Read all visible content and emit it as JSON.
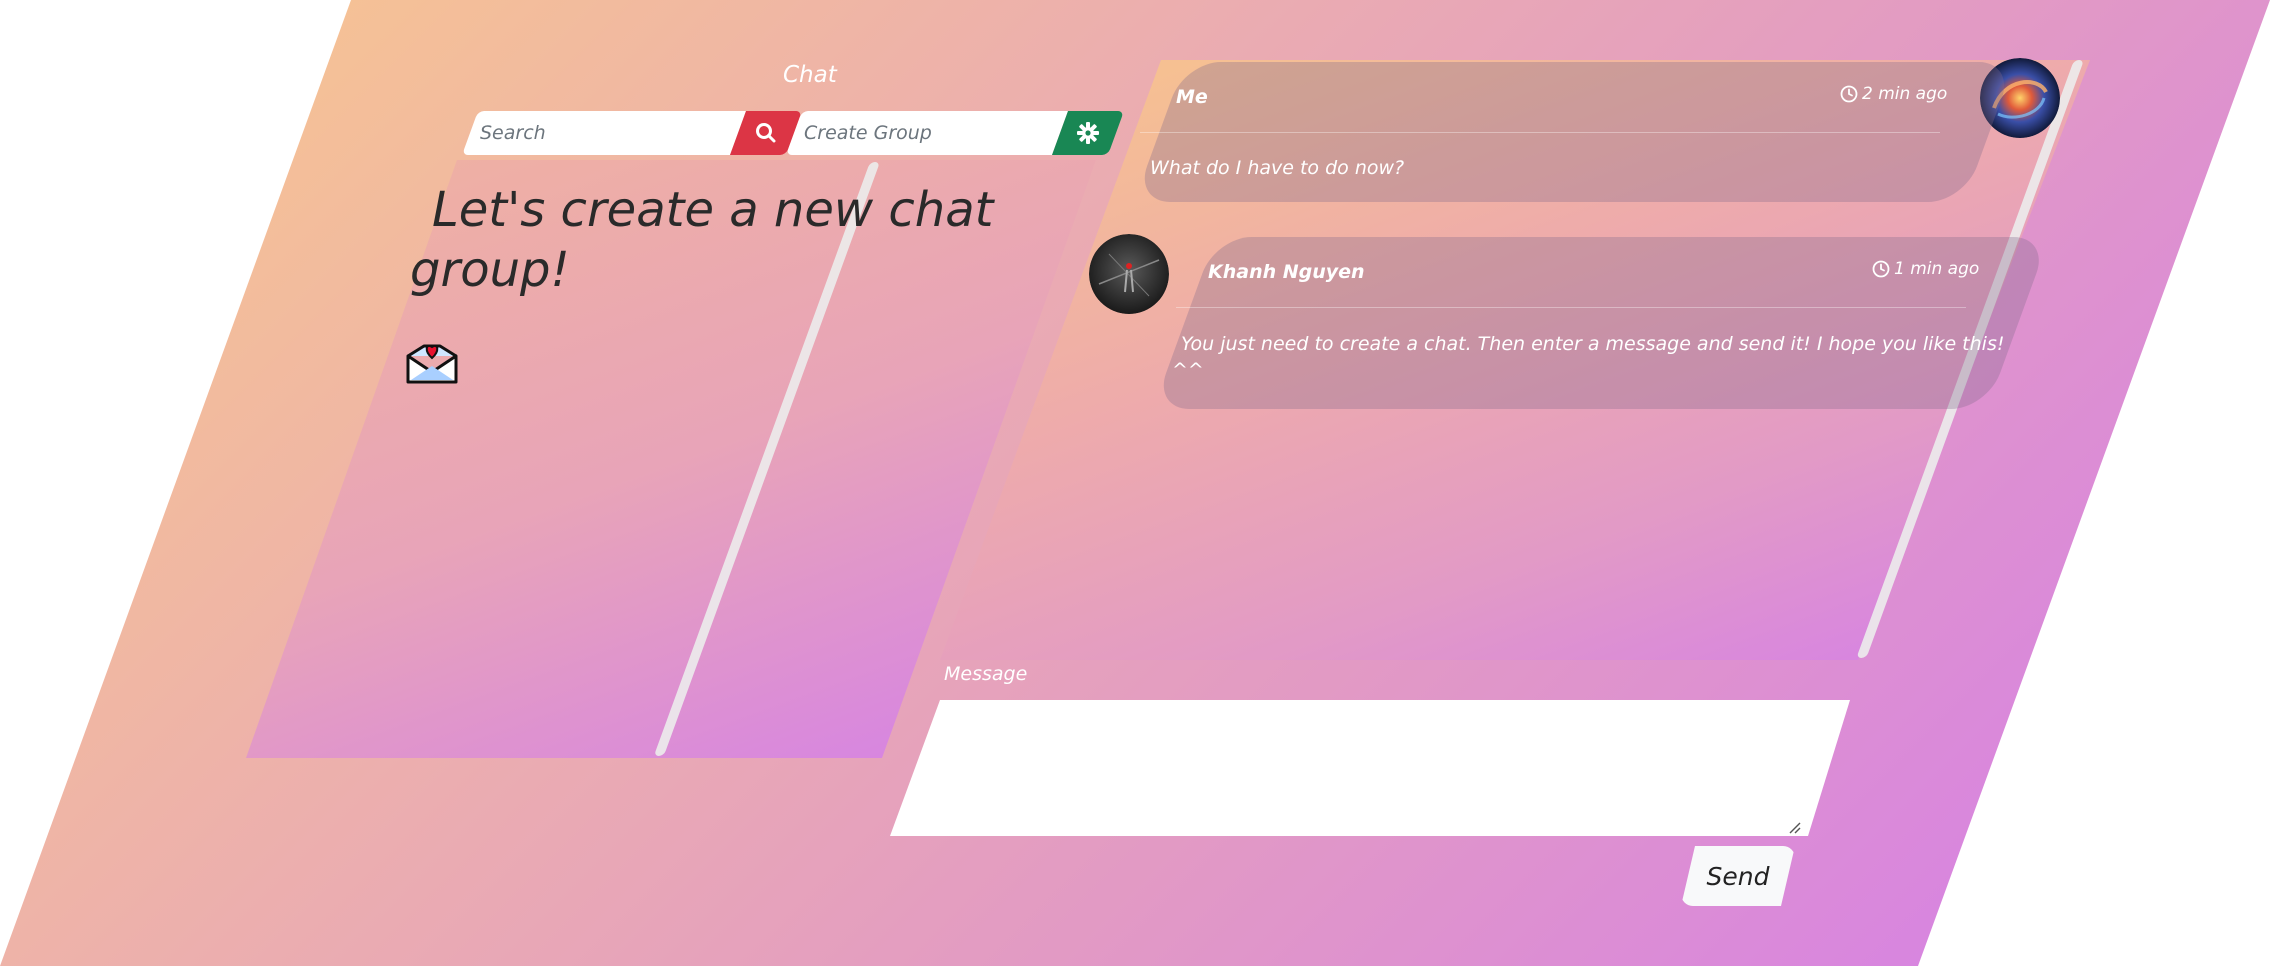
{
  "sidebar": {
    "title": "Chat",
    "search": {
      "placeholder": "Search",
      "button_icon": "search-icon"
    },
    "create_group": {
      "placeholder": "Create Group",
      "button_icon": "gear-icon"
    },
    "empty_state": {
      "title_line1": "Let's create a new chat",
      "title_line2": "group!",
      "icon": "love-letter-icon"
    }
  },
  "messages": [
    {
      "sender": "Me",
      "time": "2 min ago",
      "text": "What do I have to do now?"
    },
    {
      "sender": "Khanh Nguyen",
      "time": "1 min ago",
      "text_line1": "You just need to create a chat. Then enter a message and send it! I hope you like this!",
      "text_line2": "^^"
    }
  ],
  "composer": {
    "label": "Message",
    "value": "",
    "send_label": "Send"
  },
  "colors": {
    "search_button": "#dc3545",
    "create_group_button": "#198754",
    "gradient_start": "#f9c98c",
    "gradient_end": "#d47dea"
  }
}
